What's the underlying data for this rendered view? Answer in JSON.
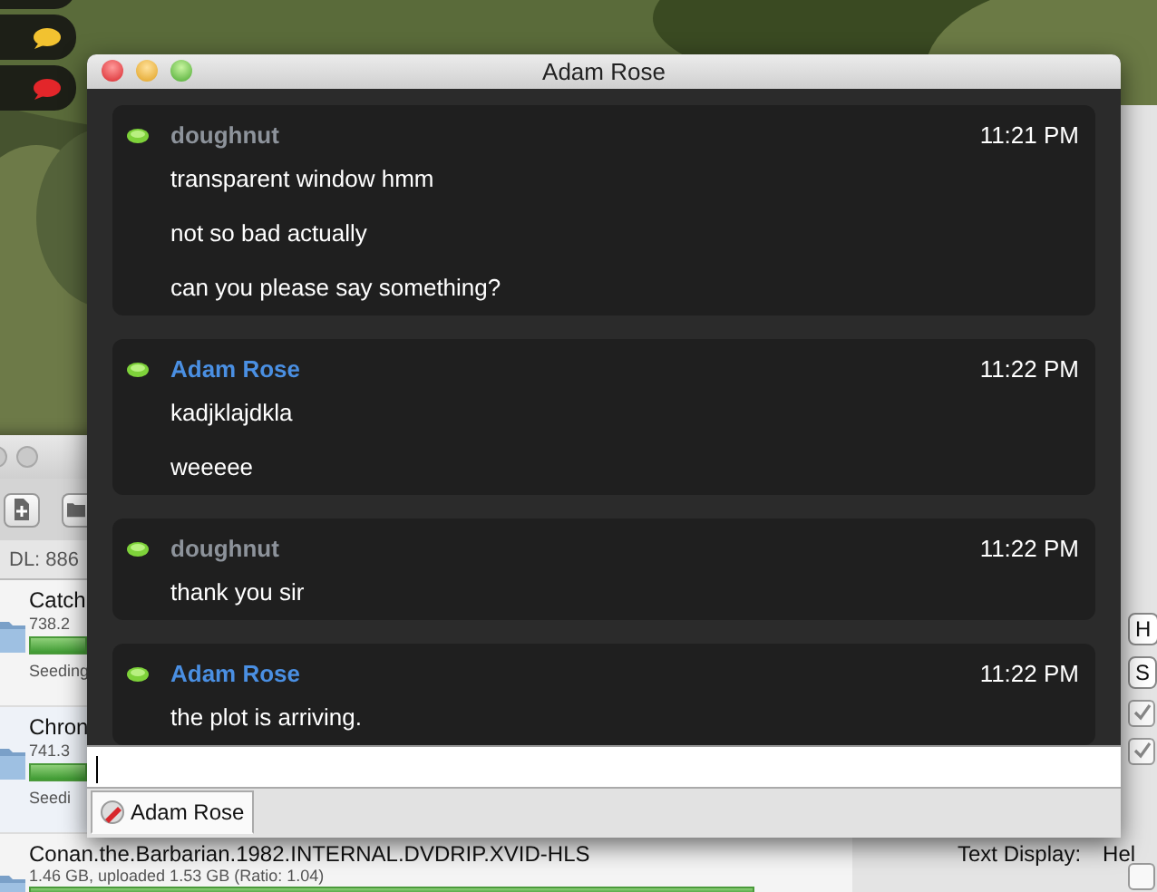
{
  "status_bubbles": [
    {
      "color": "#f2c230"
    },
    {
      "color": "#e3262a"
    }
  ],
  "transfers": {
    "stats": "DL: 886",
    "torrents": [
      {
        "name": "Catch",
        "info": "738.2",
        "status": "Seeding",
        "level": 1
      },
      {
        "name": "Chron",
        "info": "741.3",
        "status": "Seedi",
        "level": 1
      },
      {
        "name": "Conan.the.Barbarian.1982.INTERNAL.DVDRIP.XVID-HLS",
        "info": "1.46 GB, uploaded 1.53 GB (Ratio: 1.04)",
        "level": 1
      }
    ]
  },
  "preferences": {
    "popups": [
      "H",
      "S"
    ],
    "checkboxes": [
      {
        "checked": true
      },
      {
        "checked": true
      },
      {
        "checked": false
      }
    ],
    "text_display": {
      "label": "Text Display:",
      "value": "Hel"
    }
  },
  "window": {
    "title": "Adam Rose"
  },
  "messages": [
    {
      "sender": "doughnut",
      "outgoing": true,
      "time": "11:21 PM",
      "lines": [
        "transparent window hmm",
        "not so bad actually",
        "can you please say something?"
      ]
    },
    {
      "sender": "Adam Rose",
      "outgoing": false,
      "time": "11:22 PM",
      "lines": [
        "kadjklajdkla",
        "weeeee"
      ]
    },
    {
      "sender": "doughnut",
      "outgoing": true,
      "time": "11:22 PM",
      "lines": [
        "thank you sir"
      ]
    },
    {
      "sender": "Adam Rose",
      "outgoing": false,
      "time": "11:22 PM",
      "lines": [
        "the plot is arriving."
      ]
    }
  ],
  "tabs": [
    {
      "label": "Adam Rose",
      "selected": true
    }
  ]
}
